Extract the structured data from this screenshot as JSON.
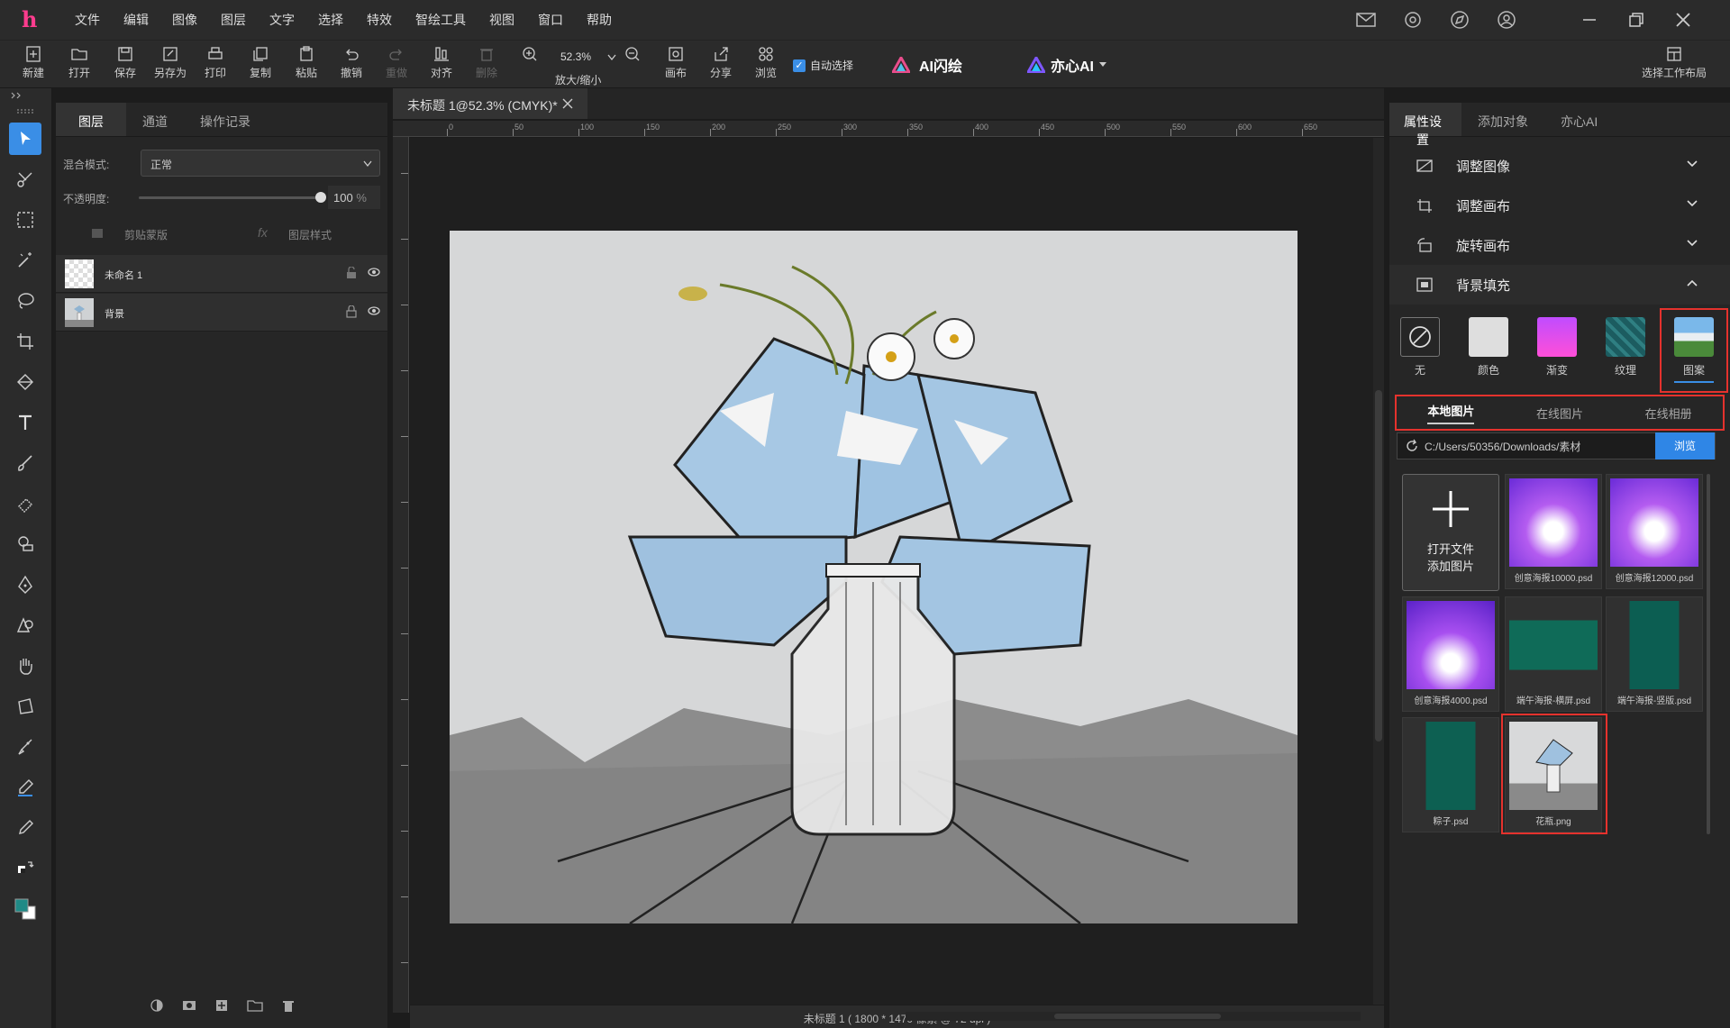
{
  "menu": [
    "文件",
    "编辑",
    "图像",
    "图层",
    "文字",
    "选择",
    "特效",
    "智绘工具",
    "视图",
    "窗口",
    "帮助"
  ],
  "toolbar": {
    "new": "新建",
    "open": "打开",
    "save": "保存",
    "saveas": "另存为",
    "print": "打印",
    "copy": "复制",
    "paste": "粘贴",
    "undo": "撤销",
    "redo": "重做",
    "align": "对齐",
    "delete": "删除",
    "zoom_value": "52.3%",
    "zoom_label": "放大/缩小",
    "canvas": "画布",
    "share": "分享",
    "browse": "浏览",
    "auto_select": "自动选择",
    "ai_flash": "AI闪绘",
    "yixin_ai": "亦心AI",
    "workspace": "选择工作布局"
  },
  "layers": {
    "tabs": [
      "图层",
      "通道",
      "操作记录"
    ],
    "blend_label": "混合模式:",
    "blend_value": "正常",
    "opacity_label": "不透明度:",
    "opacity_value": "100",
    "opacity_unit": "%",
    "opacity_level": 1.0,
    "clip_mask": "剪贴蒙版",
    "layer_style": "图层样式",
    "fx": "fx",
    "items": [
      {
        "name": "未命名 1"
      },
      {
        "name": "背景"
      }
    ]
  },
  "document": {
    "tab_title": "未标题 1@52.3% (CMYK)*",
    "status": "未标题 1 ( 1800 * 1470 像素 @ 72 dpi )",
    "ruler_marks": [
      "0",
      "50",
      "100",
      "150",
      "200",
      "250",
      "300",
      "350",
      "400",
      "450",
      "500",
      "550",
      "600",
      "650"
    ]
  },
  "right": {
    "tabs": [
      "属性设置",
      "添加对象",
      "亦心AI"
    ],
    "sections": [
      "调整图像",
      "调整画布",
      "旋转画布",
      "背景填充"
    ],
    "fills": [
      "无",
      "颜色",
      "渐变",
      "纹理",
      "图案"
    ],
    "subtabs": [
      "本地图片",
      "在线图片",
      "在线相册"
    ],
    "path": "C:/Users/50356/Downloads/素材",
    "browse_btn": "浏览",
    "open_file_line1": "打开文件",
    "open_file_line2": "添加图片",
    "thumbs": [
      "创意海报10000.psd",
      "创意海报12000.psd",
      "创意海报4000.psd",
      "端午海报-横屏.psd",
      "端午海报-竖版.psd",
      "粽子.psd",
      "花瓶.png"
    ]
  },
  "colors": {
    "accent": "#3a8ee6",
    "highlight": "#e5322d",
    "logo": "#ff3c8e"
  }
}
